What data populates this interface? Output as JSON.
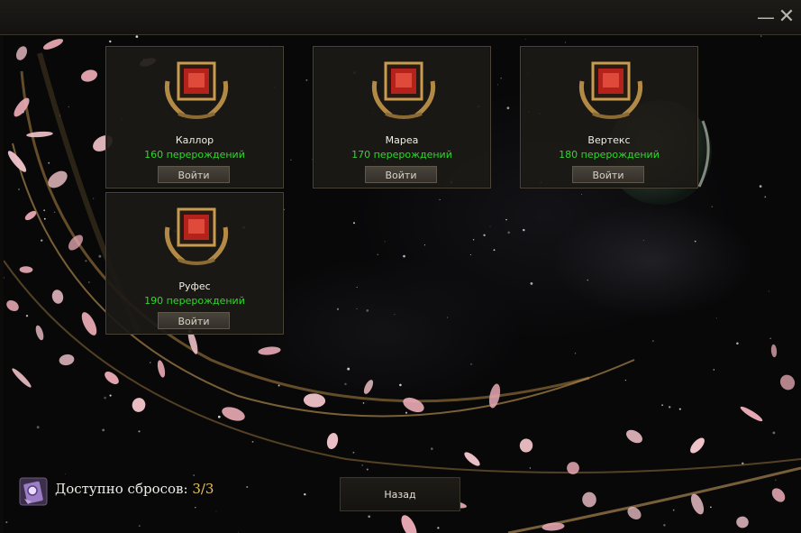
{
  "window": {
    "minimize_glyph": "—",
    "close_glyph": "✕"
  },
  "servers": [
    {
      "name": "Каллор",
      "rebirths": "160 перерождений",
      "enter_label": "Войти"
    },
    {
      "name": "Мареа",
      "rebirths": "170 перерождений",
      "enter_label": "Войти"
    },
    {
      "name": "Вертекс",
      "rebirths": "180 перерождений",
      "enter_label": "Войти"
    },
    {
      "name": "Руфес",
      "rebirths": "190 перерождений",
      "enter_label": "Войти"
    }
  ],
  "resets": {
    "label": "Доступно сбросов:",
    "count": "3/3",
    "icon": "reset-scroll-icon"
  },
  "back_label": "Назад",
  "colors": {
    "rebirths": "#2fd82c",
    "resets_count": "#e6c15b",
    "card_border": "#4a4538",
    "emblem_red": "#b3231c",
    "laurel_gold": "#b38a45"
  }
}
